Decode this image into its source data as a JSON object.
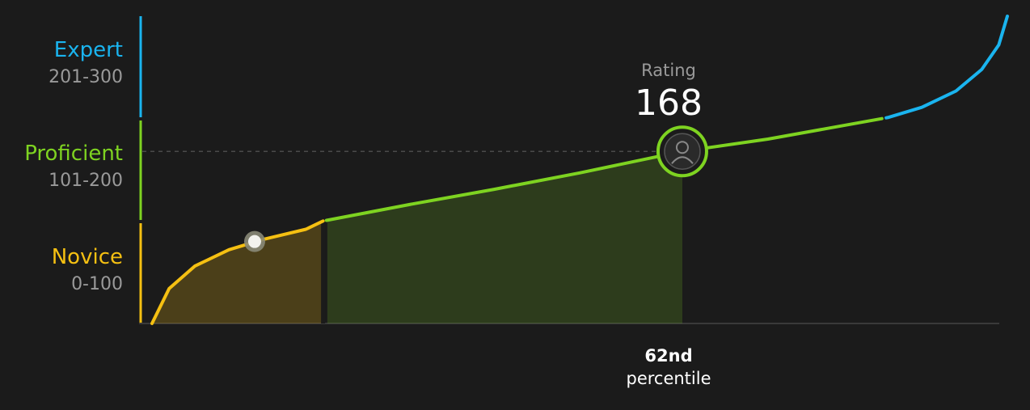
{
  "tiers": [
    {
      "name": "Expert",
      "range": "201-300",
      "color": "#1ab4ef",
      "min": 201,
      "max": 300
    },
    {
      "name": "Proficient",
      "range": "101-200",
      "color": "#7ed321",
      "min": 101,
      "max": 200
    },
    {
      "name": "Novice",
      "range": "0-100",
      "color": "#f5c012",
      "min": 0,
      "max": 100
    }
  ],
  "rating": {
    "label": "Rating",
    "value": "168"
  },
  "percentile": {
    "value": "62nd",
    "label": "percentile"
  },
  "icons": {
    "user_marker": "user-avatar-icon",
    "novice_marker": "dot-marker-icon"
  },
  "chart_data": {
    "type": "area",
    "xlabel": "",
    "ylabel": "",
    "xlim": [
      0,
      100
    ],
    "ylim": [
      0,
      300
    ],
    "grid": false,
    "user_percentile": 62,
    "user_rating": 168,
    "novice_marker": {
      "x": 12,
      "y": 80
    },
    "curve": [
      {
        "x": 0,
        "y": 0
      },
      {
        "x": 2,
        "y": 34
      },
      {
        "x": 5,
        "y": 56
      },
      {
        "x": 9,
        "y": 72
      },
      {
        "x": 13,
        "y": 82
      },
      {
        "x": 18,
        "y": 92
      },
      {
        "x": 20,
        "y": 100
      },
      {
        "x": 30,
        "y": 116
      },
      {
        "x": 40,
        "y": 131
      },
      {
        "x": 50,
        "y": 147
      },
      {
        "x": 62,
        "y": 168
      },
      {
        "x": 72,
        "y": 180
      },
      {
        "x": 80,
        "y": 192
      },
      {
        "x": 86,
        "y": 201
      },
      {
        "x": 90,
        "y": 211
      },
      {
        "x": 94,
        "y": 227
      },
      {
        "x": 97,
        "y": 248
      },
      {
        "x": 99,
        "y": 272
      },
      {
        "x": 100,
        "y": 300
      }
    ],
    "band_colors": {
      "novice": "#f5c012",
      "proficient": "#7ed321",
      "expert": "#1ab4ef"
    }
  }
}
